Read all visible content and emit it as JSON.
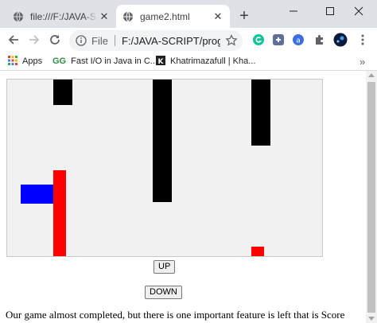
{
  "browser": {
    "tabs": [
      {
        "title": "file:///F:/JAVA-SCRIPT/",
        "active": false,
        "favicon": "globe-icon"
      },
      {
        "title": "game2.html",
        "active": true,
        "favicon": "globe-icon"
      }
    ],
    "new_tab_icon": "plus-icon",
    "window_controls": [
      "minimize-icon",
      "maximize-icon",
      "close-icon"
    ],
    "address": {
      "scheme_label": "File",
      "url": "F:/JAVA-SCRIPT/progr..."
    },
    "extensions": [
      "grammarly-icon",
      "puzzle-ext-icon",
      "circle-a-icon",
      "puzzle-icon",
      "profile-avatar"
    ],
    "bookmarks": [
      {
        "label": "Apps",
        "icon": "apps-grid-icon"
      },
      {
        "label": "Fast I/O in Java in C...",
        "icon": "gfg-icon"
      },
      {
        "label": "Khatrimazafull | Kha...",
        "icon": "k-icon"
      }
    ],
    "bookmarks_more": "»"
  },
  "game": {
    "colors": {
      "background": "#f1f1f1",
      "obstacle_top": "#000000",
      "obstacle_bottom": "#ff0000",
      "player": "#0000ff"
    },
    "up_label": "UP",
    "down_label": "DOWN"
  },
  "page": {
    "text": "Our game almost completed, but there is one important feature is left that is Score"
  }
}
